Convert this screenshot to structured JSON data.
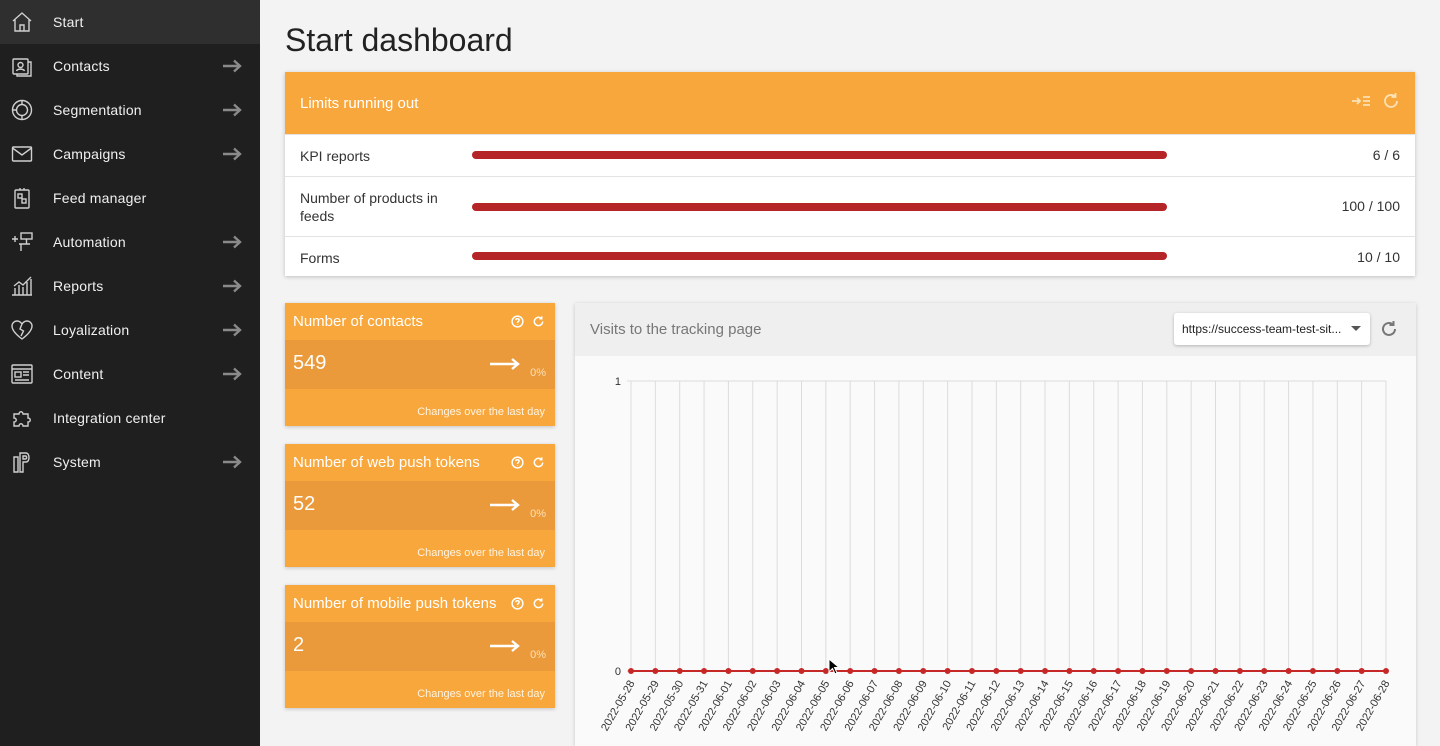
{
  "sidebar": {
    "items": [
      {
        "label": "Start",
        "icon": "home-icon",
        "active": true,
        "has_arrow": false
      },
      {
        "label": "Contacts",
        "icon": "contacts-icon",
        "has_arrow": true
      },
      {
        "label": "Segmentation",
        "icon": "segmentation-icon",
        "has_arrow": true
      },
      {
        "label": "Campaigns",
        "icon": "envelope-icon",
        "has_arrow": true
      },
      {
        "label": "Feed manager",
        "icon": "feed-icon",
        "has_arrow": false
      },
      {
        "label": "Automation",
        "icon": "automation-icon",
        "has_arrow": true
      },
      {
        "label": "Reports",
        "icon": "reports-icon",
        "has_arrow": true
      },
      {
        "label": "Loyalization",
        "icon": "heart-icon",
        "has_arrow": true
      },
      {
        "label": "Content",
        "icon": "content-icon",
        "has_arrow": true
      },
      {
        "label": "Integration center",
        "icon": "puzzle-icon",
        "has_arrow": false
      },
      {
        "label": "System",
        "icon": "system-icon",
        "has_arrow": true
      }
    ]
  },
  "page": {
    "title": "Start dashboard"
  },
  "limits": {
    "title": "Limits running out",
    "rows": [
      {
        "name": "KPI reports",
        "value": "6 / 6",
        "fill": 1.0
      },
      {
        "name": "Number of products in feeds",
        "value": "100 / 100",
        "fill": 1.0
      },
      {
        "name": "Forms",
        "value": "10 / 10",
        "fill": 1.0
      }
    ]
  },
  "stats": [
    {
      "title": "Number of contacts",
      "value": "549",
      "change": "0%",
      "footer": "Changes over the last day"
    },
    {
      "title": "Number of web push tokens",
      "value": "52",
      "change": "0%",
      "footer": "Changes over the last day"
    },
    {
      "title": "Number of mobile push tokens",
      "value": "2",
      "change": "0%",
      "footer": "Changes over the last day"
    }
  ],
  "visits": {
    "title": "Visits to the tracking page",
    "site": "https://success-team-test-sit..."
  },
  "colors": {
    "accent": "#f7a73c",
    "accent_dark": "#eb9a3b",
    "bar": "#b52427",
    "sidebar": "#1f1f1f",
    "line": "#c62828"
  },
  "chart_data": {
    "type": "line",
    "title": "Visits to the tracking page",
    "xlabel": "",
    "ylabel": "",
    "ylim": [
      0,
      1
    ],
    "y_ticks": [
      "0",
      "1"
    ],
    "grid": true,
    "x": [
      "2022-05-28",
      "2022-05-29",
      "2022-05-30",
      "2022-05-31",
      "2022-06-01",
      "2022-06-02",
      "2022-06-03",
      "2022-06-04",
      "2022-06-05",
      "2022-06-06",
      "2022-06-07",
      "2022-06-08",
      "2022-06-09",
      "2022-06-10",
      "2022-06-11",
      "2022-06-12",
      "2022-06-13",
      "2022-06-14",
      "2022-06-15",
      "2022-06-16",
      "2022-06-17",
      "2022-06-18",
      "2022-06-19",
      "2022-06-20",
      "2022-06-21",
      "2022-06-22",
      "2022-06-23",
      "2022-06-24",
      "2022-06-25",
      "2022-06-26",
      "2022-06-27",
      "2022-06-28"
    ],
    "series": [
      {
        "values": [
          0,
          0,
          0,
          0,
          0,
          0,
          0,
          0,
          0,
          0,
          0,
          0,
          0,
          0,
          0,
          0,
          0,
          0,
          0,
          0,
          0,
          0,
          0,
          0,
          0,
          0,
          0,
          0,
          0,
          0,
          0,
          0
        ]
      }
    ]
  }
}
